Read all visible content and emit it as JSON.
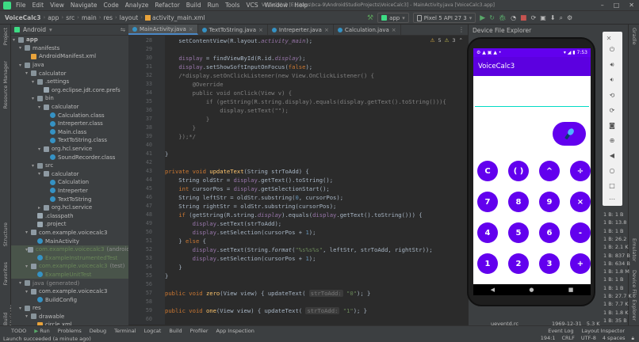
{
  "menubar": {
    "items": [
      "File",
      "Edit",
      "View",
      "Navigate",
      "Code",
      "Analyze",
      "Refactor",
      "Build",
      "Run",
      "Tools",
      "VCS",
      "Window",
      "Help"
    ],
    "window_title": "VoiceCalc3 [E:\\Users\\bca-9\\AndroidStudioProjects\\VoiceCalc3] - MainActivity.java [VoiceCalc3.app]"
  },
  "toolbar": {
    "breadcrumbs": [
      "VoiceCalc3",
      "app",
      "src",
      "main",
      "res",
      "layout",
      "activity_main.xml"
    ],
    "run_config": "app",
    "device": "Pixel 5 API 27 3"
  },
  "left_strip": [
    "Project",
    "Resource Manager",
    "Structure",
    "Favorites",
    "Build Variants"
  ],
  "right_strip": [
    "Gradle",
    "Emulator",
    "Device File Explorer"
  ],
  "project": {
    "header": "Android",
    "tree": [
      {
        "label": "app",
        "depth": 0,
        "icon": "folder",
        "open": true,
        "bold": true
      },
      {
        "label": "manifests",
        "depth": 1,
        "icon": "folder",
        "open": true
      },
      {
        "label": "AndroidManifest.xml",
        "depth": 2,
        "icon": "xml"
      },
      {
        "label": "java",
        "depth": 1,
        "icon": "folder",
        "open": true
      },
      {
        "label": "calculator",
        "depth": 2,
        "icon": "folder",
        "open": true
      },
      {
        "label": ".settings",
        "depth": 3,
        "icon": "folder",
        "open": true
      },
      {
        "label": "org.eclipse.jdt.core.prefs",
        "depth": 4,
        "icon": "file"
      },
      {
        "label": "bin",
        "depth": 3,
        "icon": "folder",
        "open": true
      },
      {
        "label": "calculator",
        "depth": 4,
        "icon": "pkg",
        "open": true
      },
      {
        "label": "Calculation.class",
        "depth": 5,
        "icon": "cls"
      },
      {
        "label": "Intreperter.class",
        "depth": 5,
        "icon": "cls"
      },
      {
        "label": "Main.class",
        "depth": 5,
        "icon": "cls"
      },
      {
        "label": "TextToString.class",
        "depth": 5,
        "icon": "cls"
      },
      {
        "label": "org.hcl.service",
        "depth": 4,
        "icon": "pkg",
        "open": true
      },
      {
        "label": "SoundRecorder.class",
        "depth": 5,
        "icon": "cls"
      },
      {
        "label": "src",
        "depth": 3,
        "icon": "folder",
        "open": true
      },
      {
        "label": "calculator",
        "depth": 4,
        "icon": "pkg",
        "open": true
      },
      {
        "label": "Calculation",
        "depth": 5,
        "icon": "cls"
      },
      {
        "label": "Intreperter",
        "depth": 5,
        "icon": "cls"
      },
      {
        "label": "TextToString",
        "depth": 5,
        "icon": "cls"
      },
      {
        "label": "org.hcl.service",
        "depth": 4,
        "icon": "pkg",
        "open": false
      },
      {
        "label": ".classpath",
        "depth": 3,
        "icon": "file"
      },
      {
        "label": ".project",
        "depth": 3,
        "icon": "file"
      },
      {
        "label": "com.example.voicecalc3",
        "depth": 2,
        "icon": "pkg",
        "open": true
      },
      {
        "label": "MainActivity",
        "depth": 3,
        "icon": "cls"
      },
      {
        "label": "com.example.voicecalc3",
        "suffix": "(androidTest)",
        "depth": 2,
        "icon": "pkg",
        "open": true,
        "test": true
      },
      {
        "label": "ExampleInstrumentedTest",
        "depth": 3,
        "icon": "cls",
        "test": true
      },
      {
        "label": "com.example.voicecalc3",
        "suffix": "(test)",
        "depth": 2,
        "icon": "pkg",
        "open": true,
        "test": true
      },
      {
        "label": "ExampleUnitTest",
        "depth": 3,
        "icon": "cls",
        "test": true
      },
      {
        "label": "java",
        "suffix": "(generated)",
        "depth": 1,
        "icon": "folder",
        "open": true,
        "gen": true
      },
      {
        "label": "com.example.voicecalc3",
        "depth": 2,
        "icon": "pkg",
        "open": true
      },
      {
        "label": "BuildConfig",
        "depth": 3,
        "icon": "cls"
      },
      {
        "label": "res",
        "depth": 1,
        "icon": "folder",
        "open": true
      },
      {
        "label": "drawable",
        "depth": 2,
        "icon": "folder",
        "open": true
      },
      {
        "label": "circle.xml",
        "depth": 3,
        "icon": "xml"
      }
    ]
  },
  "editor": {
    "tabs": [
      {
        "label": "MainActivity.java",
        "active": true
      },
      {
        "label": "TextToString.java",
        "active": false
      },
      {
        "label": "Intreperter.java",
        "active": false
      },
      {
        "label": "Calculation.java",
        "active": false
      }
    ],
    "warnings": "5",
    "weak_warnings": "3",
    "line_numbers": [
      "28",
      "29",
      "30",
      "31",
      "32",
      "33",
      "34",
      "35",
      "36",
      "37",
      "38",
      "39",
      "40",
      "41",
      "42",
      "43",
      "44",
      "45",
      "46",
      "47",
      "48",
      "49",
      "50",
      "51",
      "52",
      "53",
      "54",
      "55",
      "56",
      "57",
      "58",
      "59",
      "60"
    ]
  },
  "device_explorer": {
    "title": "Device File Explorer",
    "rows": [
      {
        "size": "1 B"
      },
      {
        "size": "13.8"
      },
      {
        "size": "1 B"
      },
      {
        "size": "26.2"
      },
      {
        "size": "2.1 K"
      },
      {
        "size": "837 B"
      },
      {
        "size": "634 B"
      },
      {
        "size": "1.8 M"
      },
      {
        "size": "1 B"
      },
      {
        "size": "1 B"
      },
      {
        "size": "27.7 K"
      },
      {
        "size": "7.7 K"
      },
      {
        "size": "1.8 K"
      },
      {
        "size": "35 B"
      },
      {
        "size": "2.4 K"
      }
    ],
    "row_prefix": "1 B:",
    "bottom_file": "ueventd.rc",
    "bottom_date": "1969-12-31",
    "bottom_size": "5.3 K"
  },
  "emulator": {
    "time": "7:53",
    "app_title": "VoiceCalc3",
    "buttons": [
      [
        "C",
        "( )",
        "^",
        "÷"
      ],
      [
        "7",
        "8",
        "9",
        "×"
      ],
      [
        "4",
        "5",
        "6",
        "-"
      ],
      [
        "1",
        "2",
        "3",
        "+"
      ],
      [
        "+/-",
        ".",
        "0",
        "="
      ]
    ]
  },
  "bottom_tabs": [
    "TODO",
    "Run",
    "Problems",
    "Debug",
    "Terminal",
    "Logcat",
    "Build",
    "Profiler",
    "App Inspection",
    "Event Log",
    "Layout Inspector"
  ],
  "status": {
    "message": "Launch succeeded (a minute ago)",
    "position": "194:1",
    "line_sep": "CRLF",
    "encoding": "UTF-8",
    "indent": "4 spaces"
  },
  "colors": {
    "accent": "#6200ee",
    "teal": "#03dac5"
  }
}
